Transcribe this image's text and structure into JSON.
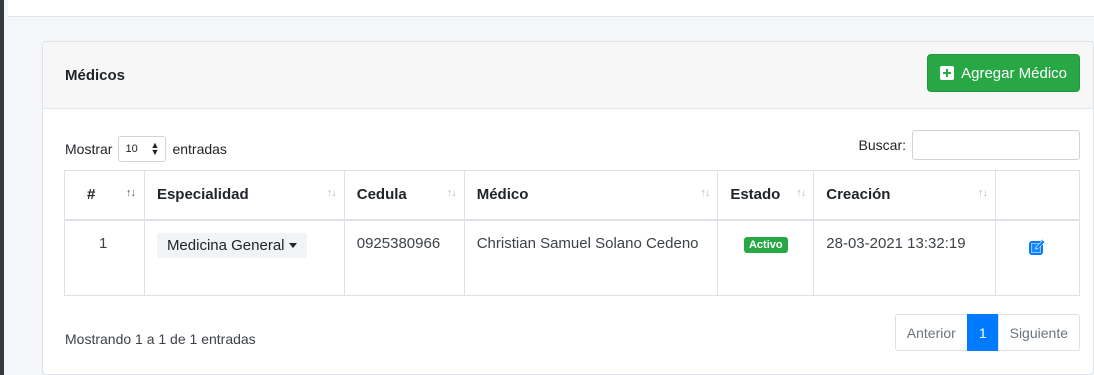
{
  "card": {
    "title": "Médicos",
    "add_label": "Agregar Médico"
  },
  "controls": {
    "show_prefix": "Mostrar",
    "page_size": "10",
    "show_suffix": "entradas",
    "search_label": "Buscar:",
    "search_value": ""
  },
  "table": {
    "columns": [
      "#",
      "Especialidad",
      "Cedula",
      "Médico",
      "Estado",
      "Creación",
      ""
    ],
    "rows": [
      {
        "num": "1",
        "especialidad": "Medicina General",
        "cedula": "0925380966",
        "medico": "Christian Samuel Solano Cedeno",
        "estado": "Activo",
        "creacion": "28-03-2021 13:32:19",
        "edit_icon": "edit-icon"
      }
    ]
  },
  "footer": {
    "info": "Mostrando 1 a 1 de 1 entradas",
    "prev": "Anterior",
    "page": "1",
    "next": "Siguiente"
  },
  "colors": {
    "success": "#28a745",
    "primary": "#007bff",
    "edit_icon": "#007bff"
  }
}
